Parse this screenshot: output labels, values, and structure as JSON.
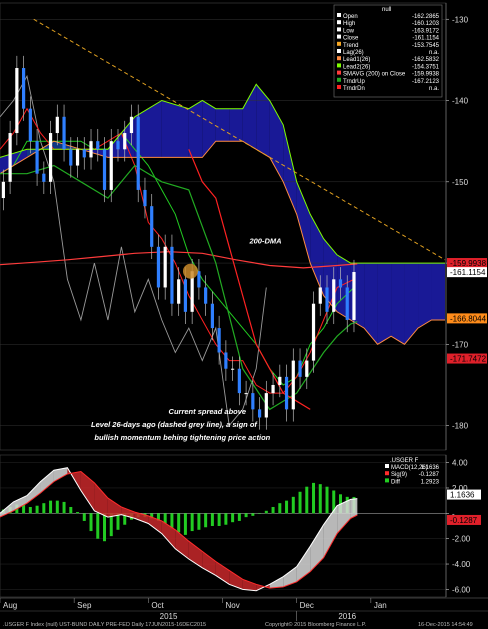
{
  "chart_data": [
    {
      "type": "line",
      "panel": "price",
      "title": "",
      "ylim": [
        -183,
        -128
      ],
      "y_ticks": [
        -130,
        -140,
        -150,
        -160,
        -170,
        -180
      ],
      "y_tick_labels": [
        "-130",
        "-140",
        "-150",
        "-160",
        "-170",
        "-180"
      ],
      "legend": {
        "header": "null",
        "items": [
          {
            "label": "Open",
            "value": "-162.2865",
            "color": "#ffffff"
          },
          {
            "label": "High",
            "value": "-160.1203",
            "color": "#ffffff"
          },
          {
            "label": "Low",
            "value": "-163.9172",
            "color": "#ffffff"
          },
          {
            "label": "Close",
            "value": "-161.1154",
            "color": "#ffffff"
          },
          {
            "label": "Trend",
            "value": "-153.7545",
            "color": "#f5a623"
          },
          {
            "label": "Lag(26)",
            "value": "n.a.",
            "color": "#ffffff"
          },
          {
            "label": "Lead1(26)",
            "value": "-162.5832",
            "color": "#ff8c42"
          },
          {
            "label": "Lead2(26)",
            "value": "-154.3751",
            "color": "#7fff00"
          },
          {
            "label": "SMAVG (200) on Close",
            "value": "-159.9938",
            "color": "#ff3b3b"
          },
          {
            "label": "TrndrUp",
            "value": "-167.2123",
            "color": "#22aa22"
          },
          {
            "label": "TrndrDn",
            "value": "n.a.",
            "color": "#ff2222"
          }
        ]
      },
      "value_tags": [
        {
          "label": "-159.9938",
          "value": -159.9938,
          "color": "#e0202a"
        },
        {
          "label": "-161.1154",
          "value": -161.1154,
          "color": "#ffffff"
        },
        {
          "label": "-166.8044",
          "value": -166.8044,
          "color": "#ff8c1a"
        },
        {
          "label": "-171.7472",
          "value": -171.7472,
          "color": "#e0202a"
        }
      ],
      "annotations": [
        {
          "text": "200-DMA"
        },
        {
          "text": "Current spread above"
        },
        {
          "text": "Level 26-days ago (dashed grey line), a sign of"
        },
        {
          "text": "bullish momentum behing tightening price action"
        }
      ],
      "series": [
        {
          "name": "Close",
          "style": "candles",
          "x": [
            1,
            3,
            5,
            7,
            9,
            11,
            13,
            15,
            17,
            19,
            21,
            23,
            25,
            27,
            29,
            31,
            33,
            35,
            37,
            39,
            41,
            43,
            45,
            47,
            49,
            51,
            53,
            55,
            57,
            59,
            61,
            63,
            65,
            67,
            69,
            71,
            73,
            75,
            77,
            79,
            81,
            83,
            85,
            87,
            89,
            91,
            93,
            95,
            97,
            99,
            101,
            103,
            105
          ],
          "y": [
            -150,
            -144,
            -136,
            -141,
            -145,
            -149,
            -150,
            -144,
            -142,
            -146,
            -148,
            -146,
            -147,
            -145,
            -146,
            -151,
            -145,
            -146,
            -144,
            -142,
            -151,
            -153,
            -158,
            -163,
            -158,
            -165,
            -162,
            -166,
            -161,
            -163,
            -165,
            -168,
            -171,
            -173,
            -173,
            -176,
            -176,
            -178,
            -179,
            -176,
            -175,
            -174,
            -178,
            -172,
            -174,
            -172,
            -165,
            -163,
            -166,
            -162,
            -163,
            -167,
            -161.1
          ]
        },
        {
          "name": "Lag(26)",
          "x": [
            0,
            4,
            8,
            12,
            16,
            20,
            24,
            28,
            32,
            36,
            40,
            44,
            48,
            52,
            56,
            60,
            64,
            68,
            72,
            76,
            79
          ],
          "y": [
            -142,
            -140,
            -137,
            -145,
            -150,
            -162,
            -167,
            -160,
            -167,
            -158,
            -166,
            -162,
            -167,
            -171,
            -168,
            -172,
            -168,
            -180,
            -178,
            -173,
            -163
          ]
        },
        {
          "name": "Kijun",
          "x": [
            0,
            4,
            8,
            12,
            16,
            20,
            24,
            28,
            32,
            36,
            40,
            44,
            48,
            52,
            56,
            60,
            64,
            68,
            72,
            76,
            80,
            84,
            88,
            92,
            96,
            100,
            105
          ],
          "y": [
            -149,
            -148,
            -145,
            -145,
            -145,
            -145,
            -145,
            -146,
            -146,
            -144,
            -146,
            -148,
            -151,
            -154,
            -159,
            -162,
            -164,
            -166,
            -168,
            -170,
            -173,
            -175,
            -174,
            -170,
            -168,
            -165,
            -163
          ]
        },
        {
          "name": "Tenkan",
          "x": [
            0,
            4,
            8,
            12,
            16,
            20,
            24,
            28,
            32,
            36,
            40,
            44,
            48,
            52,
            56,
            60,
            64,
            68,
            72,
            76,
            80,
            84,
            88,
            92,
            96,
            100,
            105
          ],
          "y": [
            -146,
            -144,
            -141,
            -144,
            -146,
            -146,
            -146,
            -146,
            -145,
            -144,
            -148,
            -155,
            -157,
            -160,
            -164,
            -167,
            -170,
            -172,
            -172,
            -175,
            -176,
            -176,
            -174,
            -171,
            -167,
            -163,
            -162
          ]
        },
        {
          "name": "Lead1(26)",
          "x": [
            0,
            8,
            16,
            24,
            32,
            40,
            48,
            56,
            60,
            64,
            68,
            72,
            76,
            80,
            84,
            88,
            92,
            96,
            100,
            104,
            108,
            112,
            116,
            120,
            124,
            128,
            132
          ],
          "y": [
            -149,
            -147,
            -145,
            -146,
            -147,
            -147,
            -147,
            -147,
            -147,
            -145,
            -145,
            -145,
            -146,
            -147,
            -150,
            -154,
            -160,
            -164,
            -166,
            -167,
            -168,
            -170,
            -169,
            -170,
            -168,
            -167,
            -167
          ]
        },
        {
          "name": "Lead2(26)",
          "x": [
            0,
            8,
            16,
            24,
            32,
            40,
            48,
            56,
            60,
            64,
            68,
            72,
            76,
            80,
            84,
            88,
            92,
            96,
            100,
            104,
            108,
            112,
            116,
            120,
            124,
            128,
            132
          ],
          "y": [
            -147,
            -146,
            -146,
            -146,
            -146,
            -142,
            -140,
            -141,
            -140,
            -141,
            -141,
            -141,
            -138,
            -140,
            -143,
            -150,
            -154,
            -157,
            -159,
            -160,
            -160,
            -160,
            -160,
            -160,
            -160,
            -160,
            -160
          ]
        },
        {
          "name": "SMAVG (200) on Close",
          "x": [
            0,
            10,
            20,
            30,
            40,
            50,
            60,
            70,
            80,
            90,
            100,
            106
          ],
          "y": [
            -160.2,
            -159.9,
            -159.6,
            -159.2,
            -158.8,
            -158.6,
            -158.8,
            -159.6,
            -160.3,
            -160.6,
            -160.3,
            -160.1
          ]
        },
        {
          "name": "Trend",
          "style": "dashed",
          "x": [
            10,
            132
          ],
          "y": [
            -130,
            -159.6
          ]
        },
        {
          "name": "TrndrUp",
          "x": [
            0,
            8,
            16,
            24,
            32,
            40,
            48,
            56,
            64,
            72,
            80,
            88,
            96,
            100,
            104,
            106
          ],
          "y": [
            -149,
            -149,
            -148,
            -150,
            -152,
            -148,
            -150,
            -151,
            -160,
            -173,
            -178,
            -176,
            -171,
            -169,
            -167.5,
            -167.2
          ]
        },
        {
          "name": "TrndrDn",
          "x": [
            56,
            60,
            64,
            68,
            72,
            76,
            80,
            84,
            88,
            92
          ],
          "y": [
            -146,
            -150,
            -152,
            -158,
            -164,
            -170,
            -173,
            -176,
            -177,
            -178
          ]
        }
      ]
    },
    {
      "type": "bar",
      "panel": "macd",
      "title": ".USGER F",
      "ylim": [
        -6.6,
        4.6
      ],
      "y_ticks": [
        4,
        2,
        0,
        -2,
        -4,
        -6
      ],
      "y_tick_labels": [
        "4.00",
        "2.00",
        "-",
        "-2.00",
        "-4.00",
        "-6.00"
      ],
      "legend": {
        "header": ".USGER F",
        "items": [
          {
            "label": "MACD(12,26)",
            "value": "1.1636",
            "color": "#ffffff"
          },
          {
            "label": "Sig(9)",
            "value": "-0.1287",
            "color": "#ff2b2b"
          },
          {
            "label": "Diff",
            "value": "1.2923",
            "color": "#22cc22"
          }
        ]
      },
      "value_tags": [
        {
          "label": "1.1636",
          "value": 1.1636,
          "color": "#ffffff"
        },
        {
          "label": "-0.1287",
          "value": -0.1287,
          "color": "#e0202a"
        }
      ],
      "series": [
        {
          "name": "MACD(12,26)",
          "x": [
            0,
            4,
            8,
            12,
            16,
            20,
            24,
            28,
            32,
            36,
            40,
            44,
            48,
            52,
            56,
            60,
            64,
            68,
            72,
            76,
            80,
            84,
            88,
            92,
            96,
            100,
            104,
            106
          ],
          "y": [
            0,
            0.9,
            1.4,
            2.5,
            3.4,
            3.6,
            1.8,
            0.2,
            -0.3,
            -0.1,
            -0.4,
            -0.8,
            -1.6,
            -2.8,
            -3.6,
            -4.3,
            -4.9,
            -5.6,
            -6.0,
            -6.1,
            -5.6,
            -5.0,
            -4.2,
            -2.6,
            -0.9,
            0.6,
            1.1,
            1.16
          ]
        },
        {
          "name": "Sig(9)",
          "x": [
            0,
            4,
            8,
            12,
            16,
            20,
            24,
            28,
            32,
            36,
            40,
            44,
            48,
            52,
            56,
            60,
            64,
            68,
            72,
            76,
            80,
            84,
            88,
            92,
            96,
            100,
            104,
            106
          ],
          "y": [
            -0.3,
            0.2,
            0.8,
            1.6,
            2.5,
            3.1,
            3.3,
            2.4,
            1.2,
            0.5,
            0.1,
            -0.2,
            -0.6,
            -1.3,
            -2.2,
            -3.0,
            -3.8,
            -4.5,
            -5.2,
            -5.6,
            -5.9,
            -5.8,
            -5.4,
            -4.6,
            -3.5,
            -1.6,
            -0.4,
            -0.13
          ]
        },
        {
          "name": "Diff",
          "x": [
            1,
            3,
            5,
            7,
            9,
            11,
            13,
            15,
            17,
            19,
            21,
            23,
            25,
            27,
            29,
            31,
            33,
            35,
            37,
            39,
            41,
            43,
            45,
            47,
            49,
            51,
            53,
            55,
            57,
            59,
            61,
            63,
            65,
            67,
            69,
            71,
            73,
            75,
            77,
            79,
            81,
            83,
            85,
            87,
            89,
            91,
            93,
            95,
            97,
            99,
            101,
            103,
            105
          ],
          "y": [
            0.3,
            0.5,
            0.7,
            0.7,
            0.5,
            0.6,
            0.8,
            1.0,
            1.0,
            0.9,
            0.5,
            0.1,
            -0.6,
            -1.4,
            -2.0,
            -2.2,
            -1.8,
            -1.3,
            -0.9,
            -0.5,
            -0.3,
            -0.3,
            -0.4,
            -0.6,
            -0.8,
            -1.2,
            -1.5,
            -1.7,
            -1.4,
            -1.3,
            -1.1,
            -1.0,
            -1.0,
            -0.9,
            -0.7,
            -0.6,
            -0.3,
            -0.2,
            0,
            0.2,
            0.5,
            0.8,
            1.0,
            1.3,
            1.7,
            2.1,
            2.4,
            2.3,
            2.1,
            1.8,
            1.5,
            1.3,
            1.29
          ]
        }
      ]
    }
  ],
  "x_axis": {
    "month_labels": [
      {
        "label": "Aug",
        "x": 0
      },
      {
        "label": "Sep",
        "x": 22
      },
      {
        "label": "Oct",
        "x": 44
      },
      {
        "label": "Nov",
        "x": 66
      },
      {
        "label": "Dec",
        "x": 88
      },
      {
        "label": "Jan",
        "x": 110
      }
    ],
    "year_labels": [
      {
        "label": "2015",
        "x": 50
      },
      {
        "label": "2016",
        "x": 103
      }
    ]
  },
  "footer": {
    "left": ".USGER F Index (null) UST-BUND DAILY PRE-FED  Daily 17JUN2015-16DEC2015",
    "center": "Copyright© 2015 Bloomberg Finance L.P.",
    "right": "16-Dec-2015 14:54:49"
  }
}
